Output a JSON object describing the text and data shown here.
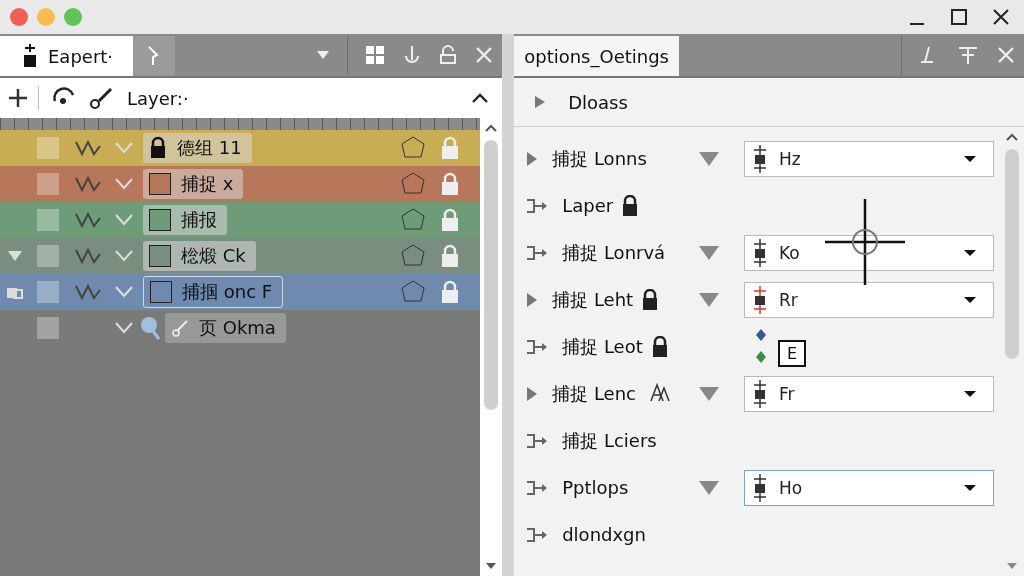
{
  "left_panel": {
    "tabs": [
      {
        "label": "Eapert·",
        "selected": true
      },
      {
        "selected": false
      }
    ],
    "toolbar": {
      "label": "Layer:·"
    },
    "layers": [
      {
        "name": "德组 11",
        "color": "#c9ad55",
        "locked": true,
        "selected": false,
        "expandable": false
      },
      {
        "name": "捕捉 x",
        "color": "#b8775a",
        "locked": false,
        "selected": false,
        "expandable": false
      },
      {
        "name": "捕报",
        "color": "#6e9c78",
        "locked": false,
        "selected": false,
        "expandable": false
      },
      {
        "name": "棇煅 Ck",
        "color": "#7a8e80",
        "locked": false,
        "selected": false,
        "expandable": true
      },
      {
        "name": "捕掴 onc F",
        "color": "#6f8aae",
        "locked": false,
        "selected": true,
        "expandable": false,
        "children": [
          {
            "name": "页 Okma",
            "color": "#7a7a78"
          }
        ]
      }
    ]
  },
  "right_panel": {
    "tab": "options_Oetings",
    "section": "Dloass",
    "rows": [
      {
        "kind": "expand",
        "label": "捕捉 Lonns",
        "locked": false,
        "dropdown": "Hz"
      },
      {
        "kind": "arrow",
        "label": "Laper",
        "locked": true
      },
      {
        "kind": "arrow",
        "label": "捕捉 Lonrvá",
        "locked": false,
        "dropdown": "Ko"
      },
      {
        "kind": "expand",
        "label": "捕捉 Leht",
        "locked": true,
        "dropdown": "Rr"
      },
      {
        "kind": "arrow",
        "label": "捕捉 Leot",
        "locked": true,
        "marker": "E"
      },
      {
        "kind": "expand",
        "label": "捕捉 Lenc",
        "locked": false,
        "dropdown": "Fr"
      },
      {
        "kind": "arrow",
        "label": "捕捉 Lciers",
        "locked": false
      },
      {
        "kind": "arrow",
        "label": "Pptlops",
        "locked": false,
        "dropdown": "Ho",
        "focused": true
      },
      {
        "kind": "arrow",
        "label": "dlondxgn",
        "locked": false
      }
    ]
  }
}
